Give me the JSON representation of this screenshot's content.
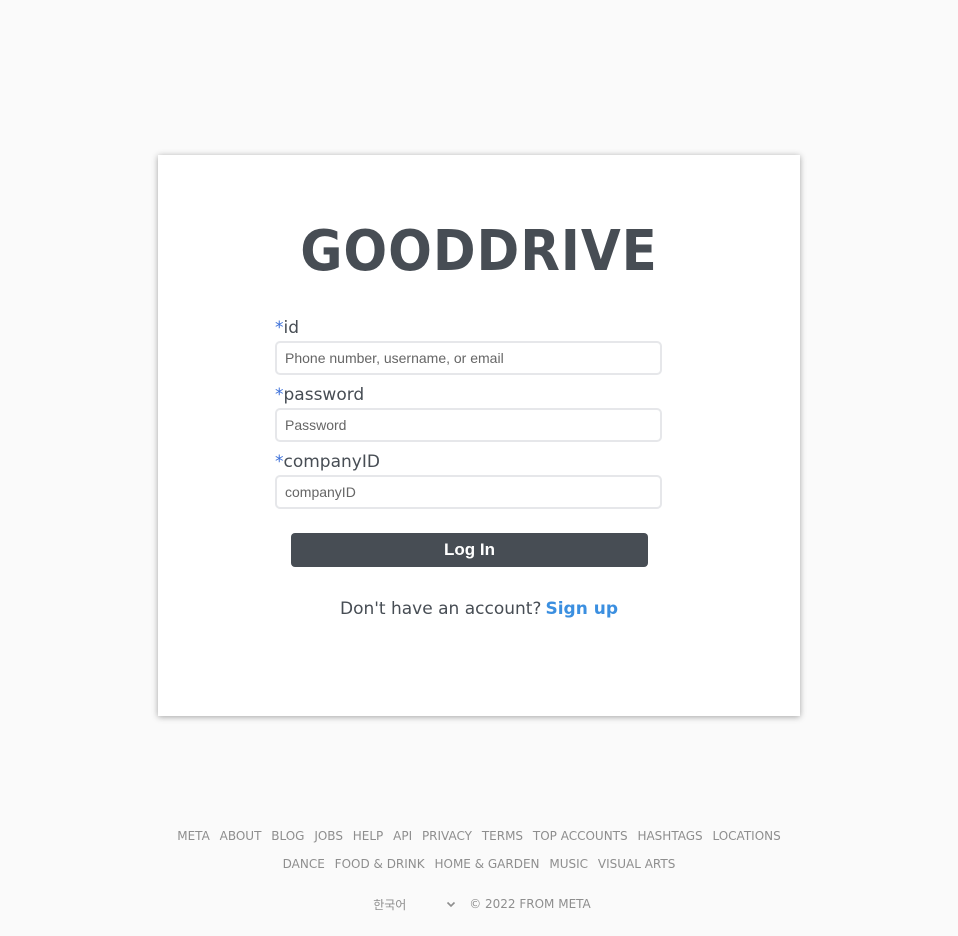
{
  "brand": {
    "name": "GOODDRIVE"
  },
  "form": {
    "fields": [
      {
        "required_mark": "*",
        "label": "id",
        "placeholder": "Phone number, username, or email",
        "value": ""
      },
      {
        "required_mark": "*",
        "label": "password",
        "placeholder": "Password",
        "value": ""
      },
      {
        "required_mark": "*",
        "label": "companyID",
        "placeholder": "companyID",
        "value": ""
      }
    ],
    "login_label": "Log In",
    "signup_prompt": "Don't have an account?",
    "signup_label": "Sign up"
  },
  "footer": {
    "links_row1": [
      "META",
      "ABOUT",
      "BLOG",
      "JOBS",
      "HELP",
      "API",
      "PRIVACY",
      "TERMS",
      "TOP ACCOUNTS",
      "HASHTAGS",
      "LOCATIONS"
    ],
    "links_row2": [
      "DANCE",
      "FOOD & DRINK",
      "HOME & GARDEN",
      "MUSIC",
      "VISUAL ARTS"
    ],
    "language": {
      "selected": "한국어",
      "icon": "chevron-down-icon"
    },
    "copyright": "© 2022 FROM META"
  },
  "colors": {
    "brand": "#474d54",
    "accent_link": "#3b8fe0",
    "required_mark": "#3b6fd8",
    "background": "#fafafa"
  }
}
